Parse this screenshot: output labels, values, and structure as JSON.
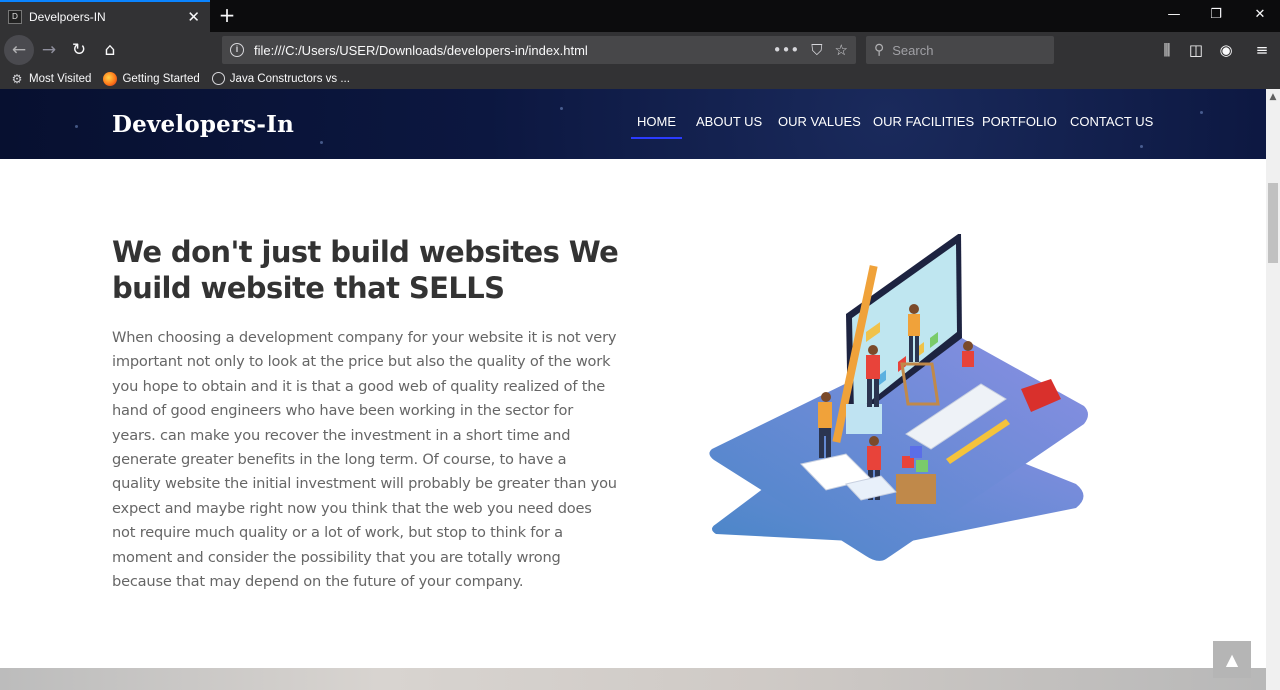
{
  "browser": {
    "tab_title": "Develpoers-IN",
    "tab_favicon_text": "D",
    "url": "file:///C:/Users/USER/Downloads/developers-in/index.html",
    "search_placeholder": "Search",
    "bookmarks": [
      {
        "label": "Most Visited",
        "icon": "gear-icon"
      },
      {
        "label": "Getting Started",
        "icon": "firefox-icon"
      },
      {
        "label": "Java Constructors vs ...",
        "icon": "globe-icon"
      }
    ]
  },
  "site": {
    "logo": "Developers-In",
    "nav": [
      {
        "label": "HOME",
        "active": true
      },
      {
        "label": "ABOUT US"
      },
      {
        "label": "OUR VALUES"
      },
      {
        "label": "OUR FACILITIES"
      },
      {
        "label": "PORTFOLIO"
      },
      {
        "label": "CONTACT US"
      }
    ],
    "hero": {
      "title": "We don't just build websites We build website that SELLS",
      "body": "When choosing a development company for your website it is not very important not only to look at the price but also the quality of the work you hope to obtain and it is that a good web of quality realized of the hand of good engineers who have been working in the sector for years. can make you recover the investment in a short time and generate greater benefits in the long term. Of course, to have a quality website the initial investment will probably be greater than you expect and maybe right now you think that the web you need does not require much quality or a lot of work, but stop to think for a moment and consider the possibility that you are totally wrong because that may depend on the future of your company."
    },
    "back_to_top_icon": "chevron-up-icon"
  },
  "colors": {
    "header_bg": "#0c1740",
    "nav_active_underline": "#2b3bff",
    "title_text": "#333333",
    "body_text": "#666666",
    "platform_blue": "#5b8fd0",
    "platform_purple": "#8a8fe0"
  }
}
